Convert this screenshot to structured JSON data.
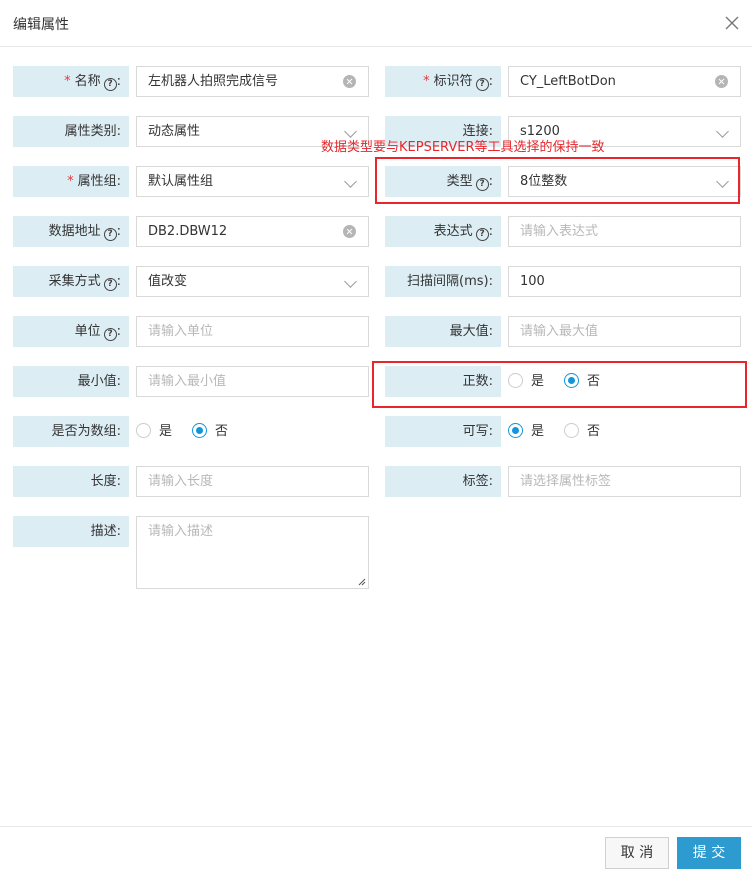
{
  "dialog": {
    "title": "编辑属性"
  },
  "annotation": {
    "text": "数据类型要与KEPSERVER等工具选择的保持一致"
  },
  "fields": {
    "name": {
      "label": "名称",
      "value": "左机器人拍照完成信号"
    },
    "identifier": {
      "label": "标识符",
      "value": "CY_LeftBotDon"
    },
    "attr_category": {
      "label": "属性类别:",
      "value": "动态属性"
    },
    "connection": {
      "label": "连接:",
      "value": "s1200"
    },
    "attr_group": {
      "label": "属性组:",
      "value": "默认属性组"
    },
    "type": {
      "label": "类型",
      "value": "8位整数"
    },
    "data_address": {
      "label": "数据地址",
      "value": "DB2.DBW12"
    },
    "expression": {
      "label": "表达式",
      "placeholder": "请输入表达式"
    },
    "collect_mode": {
      "label": "采集方式",
      "value": "值改变"
    },
    "scan_interval": {
      "label": "扫描间隔(ms):",
      "value": "100"
    },
    "unit": {
      "label": "单位",
      "placeholder": "请输入单位"
    },
    "max_value": {
      "label": "最大值:",
      "placeholder": "请输入最大值"
    },
    "min_value": {
      "label": "最小值:",
      "placeholder": "请输入最小值"
    },
    "positive": {
      "label": "正数:",
      "opt_yes": "是",
      "opt_no": "否",
      "selected": "否"
    },
    "is_array": {
      "label": "是否为数组:",
      "opt_yes": "是",
      "opt_no": "否",
      "selected": "否"
    },
    "writable": {
      "label": "可写:",
      "opt_yes": "是",
      "opt_no": "否",
      "selected": "是"
    },
    "length": {
      "label": "长度:",
      "placeholder": "请输入长度"
    },
    "tags": {
      "label": "标签:",
      "placeholder": "请选择属性标签"
    },
    "description": {
      "label": "描述:",
      "placeholder": "请输入描述"
    }
  },
  "footer": {
    "cancel_label": "取 消",
    "submit_label": "提 交"
  },
  "colors": {
    "label_bg": "#dcedf4",
    "accent": "#2e9bd0",
    "annotation_red": "#e8262b",
    "required": "#e0393e"
  }
}
